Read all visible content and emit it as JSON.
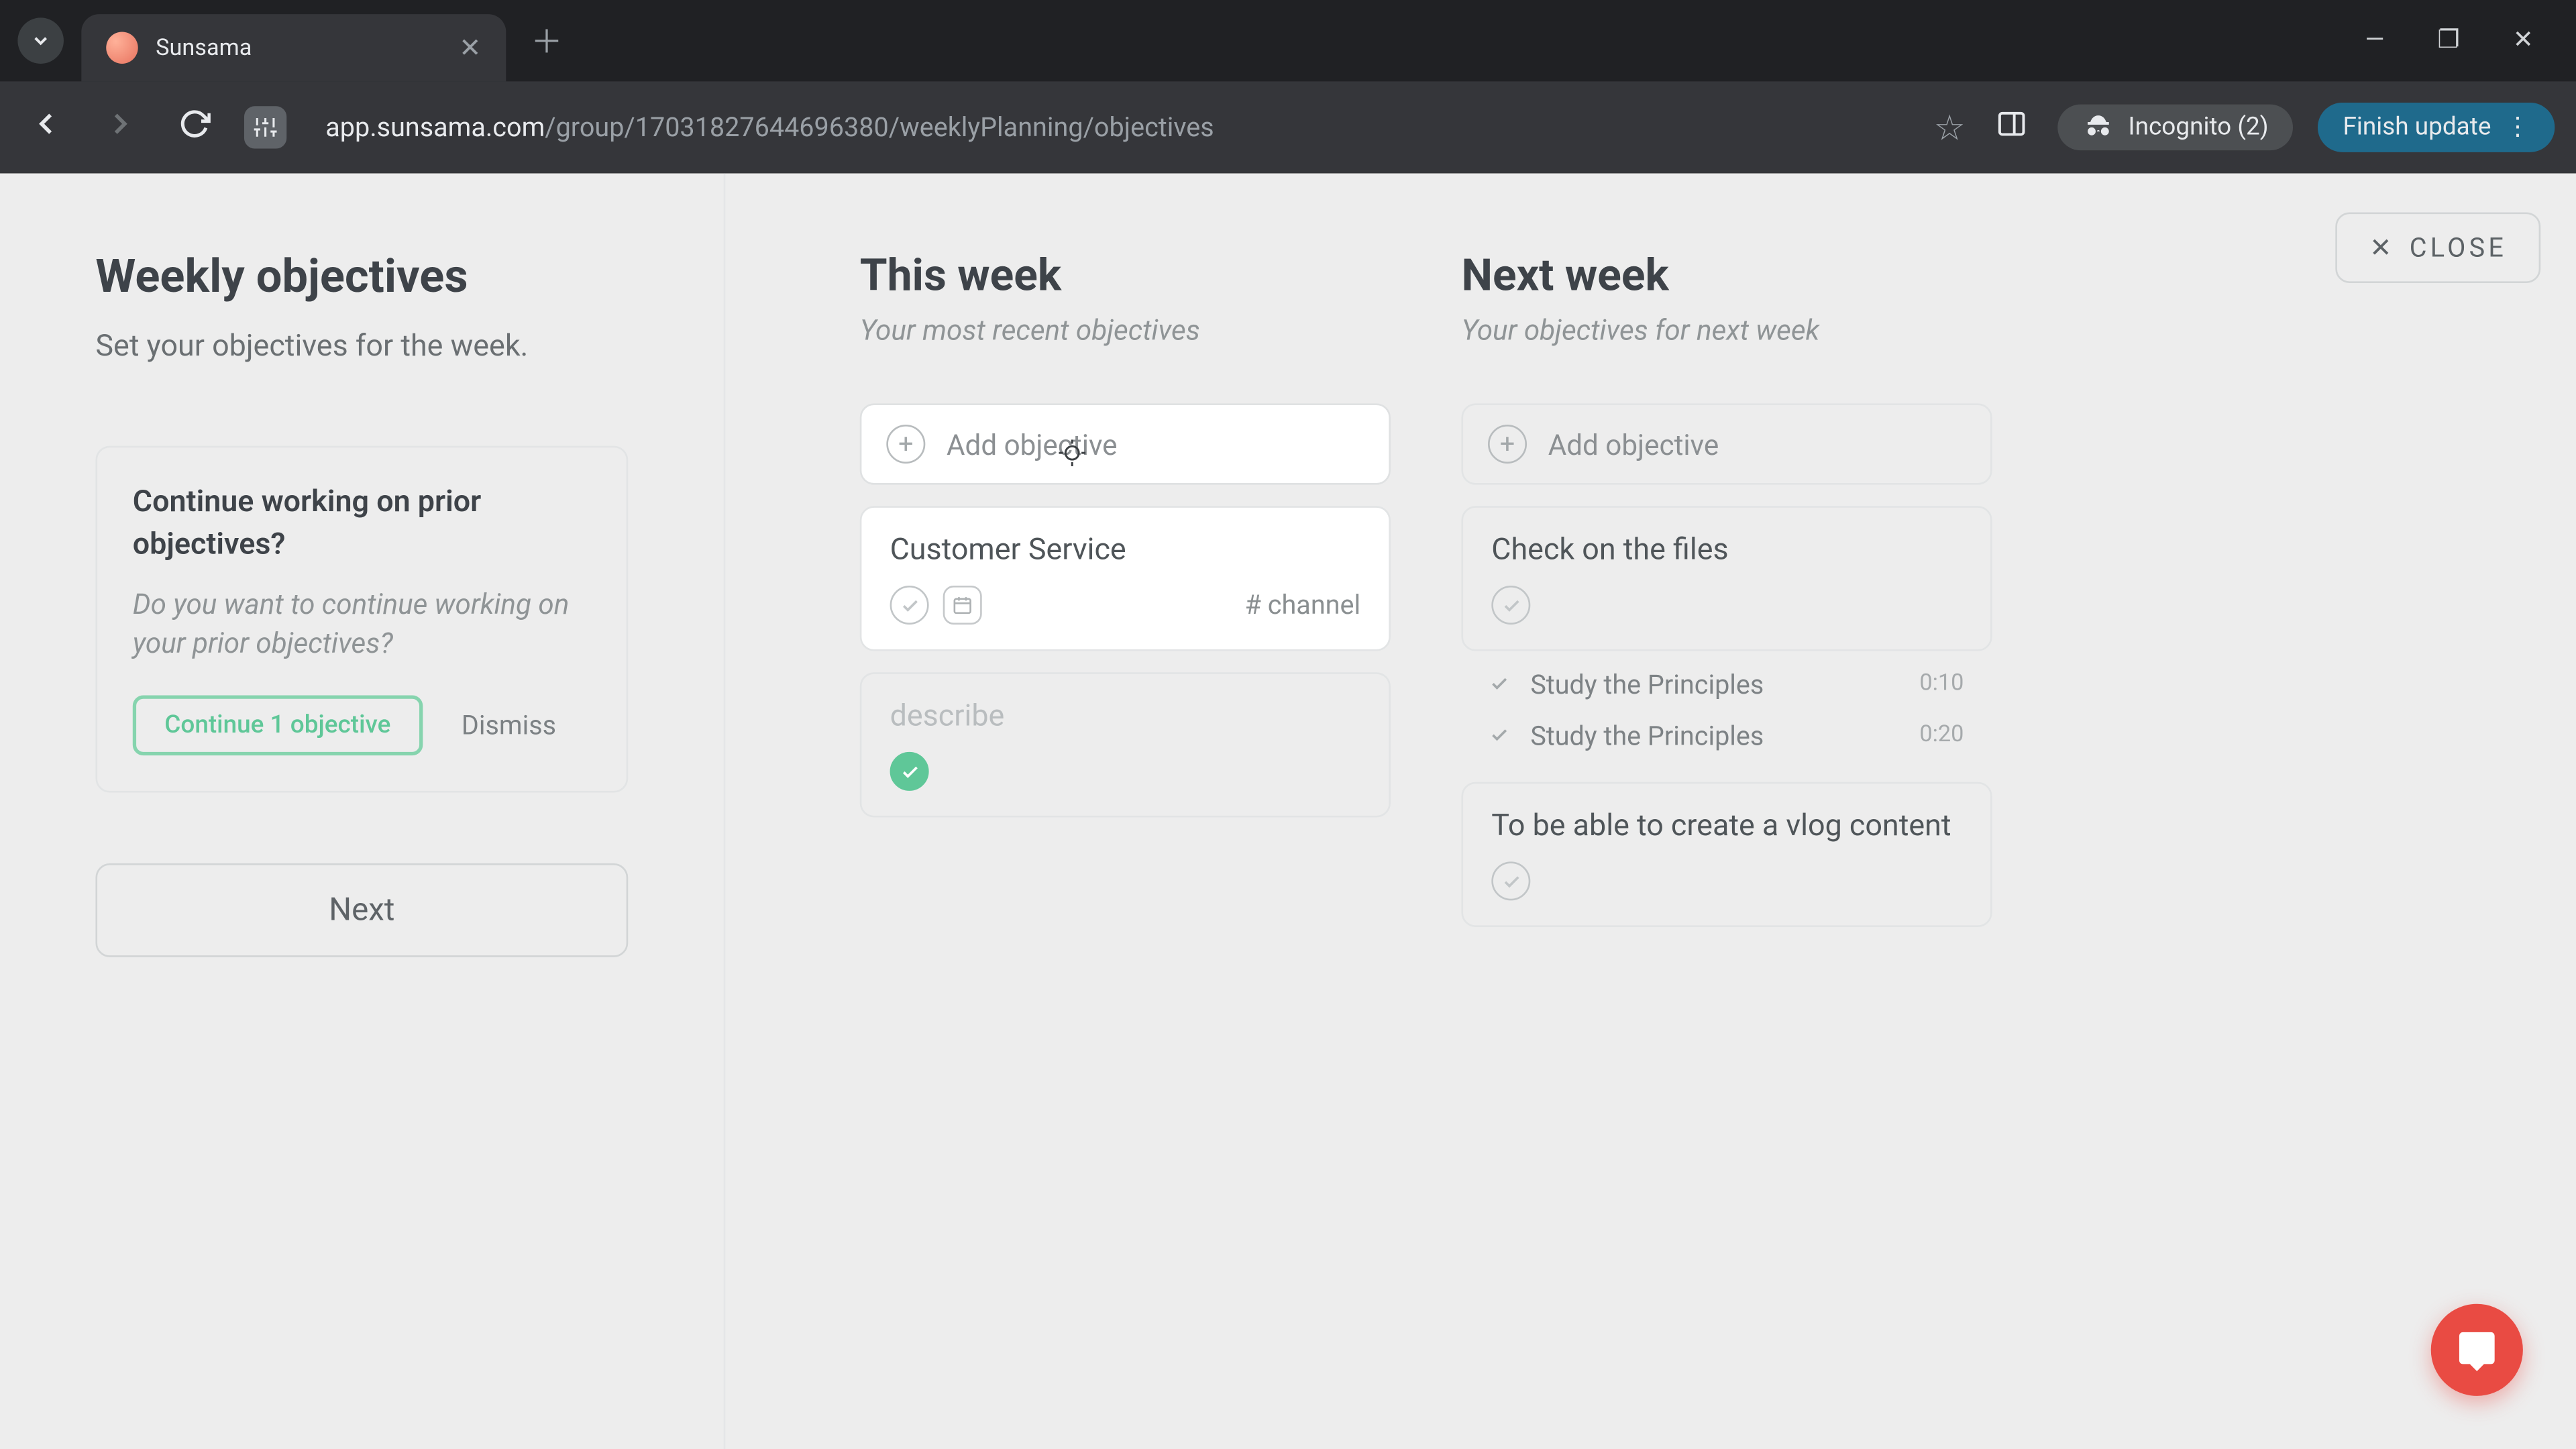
{
  "browser": {
    "tab_title": "Sunsama",
    "url_display": "app.sunsama.com/group/17031827644696380/weeklyPlanning/objectives",
    "url_host": "app.sunsama.com",
    "url_path": "/group/17031827644696380/weeklyPlanning/objectives",
    "incognito": "Incognito (2)",
    "finish_update": "Finish update"
  },
  "close_label": "CLOSE",
  "sidebar": {
    "heading": "Weekly objectives",
    "subheading": "Set your objectives for the week.",
    "prompt_title": "Continue working on prior objectives?",
    "prompt_desc": "Do you want to continue working on your prior objectives?",
    "continue_label": "Continue 1 objective",
    "dismiss_label": "Dismiss",
    "next_label": "Next"
  },
  "columns": {
    "this_week": {
      "title": "This week",
      "subtitle": "Your most recent objectives",
      "add_label": "Add objective",
      "cards": [
        {
          "title": "Customer Service",
          "channel": "# channel",
          "done": false,
          "has_date": true
        },
        {
          "title": "describe",
          "done": true
        }
      ]
    },
    "next_week": {
      "title": "Next week",
      "subtitle": "Your objectives for next week",
      "add_label": "Add objective",
      "cards": [
        {
          "title": "Check on the files",
          "subtasks": [
            {
              "label": "Study the Principles",
              "time": "0:10"
            },
            {
              "label": "Study the Principles",
              "time": "0:20"
            }
          ]
        },
        {
          "title": "To be able to create a vlog content"
        }
      ]
    }
  }
}
